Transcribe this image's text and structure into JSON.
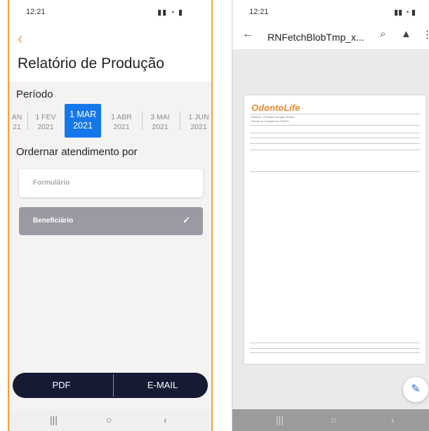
{
  "left": {
    "status": {
      "time": "12:21",
      "icons": "☐ ▣ ■",
      "right_icons": "📶 ▮"
    },
    "title": "Relatório de Produção",
    "period_label": "Período",
    "periods": [
      {
        "month": "AN",
        "year": "21"
      },
      {
        "month": "1 FEV",
        "year": "2021"
      },
      {
        "month": "1 MAR",
        "year": "2021",
        "active": true
      },
      {
        "month": "1 ABR",
        "year": "2021"
      },
      {
        "month": "3 MAI",
        "year": "2021"
      },
      {
        "month": "1 JUN",
        "year": "2021"
      }
    ],
    "order_label": "Ordernar atendimento por",
    "options": [
      {
        "label": "Formulário",
        "selected": false
      },
      {
        "label": "Beneficiário",
        "selected": true
      }
    ],
    "pdf_label": "PDF",
    "email_label": "E-MAIL",
    "accent": "#f5a33a",
    "active_color": "#1578ea"
  },
  "right": {
    "status": {
      "time": "12:21"
    },
    "title": "RNFetchBlobTmp_x...",
    "doc": {
      "logo": "OdontoLife",
      "line1": "Relatório - Produção Cirurgião Dentista",
      "line2": "Período de Competência: 03/2021"
    }
  }
}
